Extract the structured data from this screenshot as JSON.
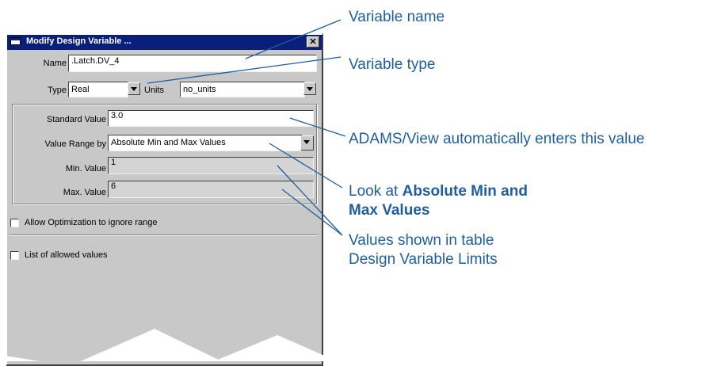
{
  "dialog": {
    "title": "Modify Design Variable ...",
    "close_label": "✕",
    "name_label": "Name",
    "name_value": ".Latch.DV_4",
    "type_label": "Type",
    "type_value": "Real",
    "units_label": "Units",
    "units_value": "no_units",
    "standard_value_label": "Standard Value",
    "standard_value": "3.0",
    "value_range_label": "Value Range by",
    "value_range_value": "Absolute Min and Max Values",
    "min_label": "Min. Value",
    "min_value": "1",
    "max_label": "Max. Value",
    "max_value": "6",
    "allow_opt_label": "Allow Optimization to ignore range",
    "allowed_values_label": "List of allowed values"
  },
  "annotations": {
    "variable_name": "Variable name",
    "variable_type": "Variable type",
    "auto_enter": "ADAMS/View automatically enters this value",
    "look_at_prefix": "Look at ",
    "look_at_bold1": "Absolute Min and",
    "look_at_bold2": "Max Values",
    "values_shown_1": "Values shown in table",
    "values_shown_2": "Design Variable Limits"
  },
  "colors": {
    "annotation_text": "#1f5f9e",
    "title_bar": "#0a1f7a",
    "dialog_bg": "#c8c8c8"
  }
}
